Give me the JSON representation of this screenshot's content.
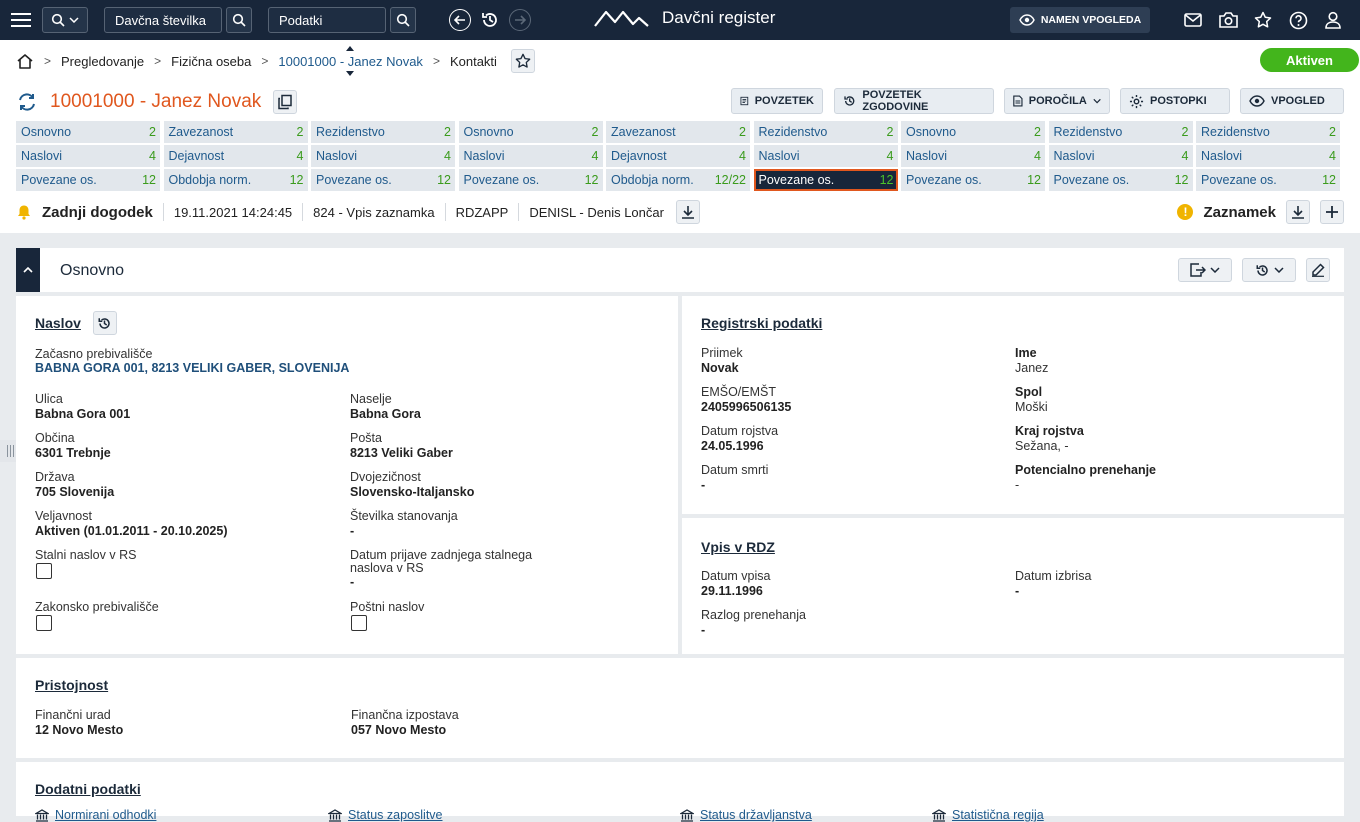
{
  "topbar": {
    "search_type": "Davčna številka",
    "search_field": "Podatki",
    "app_title": "Davčni register",
    "namen_button": "NAMEN VPOGLEDA"
  },
  "breadcrumb": {
    "items": [
      "Pregledovanje",
      "Fizična oseba",
      "10001000 - Janez Novak",
      "Kontakti"
    ]
  },
  "status_badge": "Aktiven",
  "page_title": "10001000 - Janez Novak",
  "actions": {
    "povzetek": "POVZETEK",
    "povzetek_zgodovine": "POVZETEK ZGODOVINE",
    "porocila": "POROČILA",
    "postopki": "POSTOPKI",
    "vpogled": "VPOGLED"
  },
  "tabs": [
    {
      "label": "Osnovno",
      "count": "2"
    },
    {
      "label": "Zavezanost",
      "count": "2"
    },
    {
      "label": "Rezidenstvo",
      "count": "2"
    },
    {
      "label": "Osnovno",
      "count": "2"
    },
    {
      "label": "Zavezanost",
      "count": "2"
    },
    {
      "label": "Rezidenstvo",
      "count": "2"
    },
    {
      "label": "Osnovno",
      "count": "2"
    },
    {
      "label": "Rezidenstvo",
      "count": "2"
    },
    {
      "label": "Rezidenstvo",
      "count": "2"
    },
    {
      "label": "Naslovi",
      "count": "4"
    },
    {
      "label": "Dejavnost",
      "count": "4"
    },
    {
      "label": "Naslovi",
      "count": "4"
    },
    {
      "label": "Naslovi",
      "count": "4"
    },
    {
      "label": "Dejavnost",
      "count": "4"
    },
    {
      "label": "Naslovi",
      "count": "4"
    },
    {
      "label": "Naslovi",
      "count": "4"
    },
    {
      "label": "Naslovi",
      "count": "4"
    },
    {
      "label": "Naslovi",
      "count": "4"
    },
    {
      "label": "Povezane os.",
      "count": "12"
    },
    {
      "label": "Obdobja norm.",
      "count": "12"
    },
    {
      "label": "Povezane os.",
      "count": "12"
    },
    {
      "label": "Povezane os.",
      "count": "12"
    },
    {
      "label": "Obdobja norm.",
      "count": "12/22"
    },
    {
      "label": "Povezane os.",
      "count": "12",
      "selected": true
    },
    {
      "label": "Povezane os.",
      "count": "12"
    },
    {
      "label": "Povezane os.",
      "count": "12"
    },
    {
      "label": "Povezane os.",
      "count": "12"
    }
  ],
  "event": {
    "label": "Zadnji dogodek",
    "datetime": "19.11.2021 14:24:45",
    "type": "824 - Vpis zaznamka",
    "app": "RDZAPP",
    "user": "DENISL - Denis Lončar",
    "note_label": "Zaznamek"
  },
  "section": {
    "title": "Osnovno"
  },
  "naslov": {
    "title": "Naslov",
    "temp_label": "Začasno prebivališče",
    "temp_value": "BABNA GORA 001, 8213 VELIKI GABER, SLOVENIJA",
    "ulica_l": "Ulica",
    "ulica_v": "Babna Gora 001",
    "naselje_l": "Naselje",
    "naselje_v": "Babna Gora",
    "obcina_l": "Občina",
    "obcina_v": "6301 Trebnje",
    "posta_l": "Pošta",
    "posta_v": "8213 Veliki Gaber",
    "drzava_l": "Država",
    "drzava_v": "705 Slovenija",
    "dvoj_l": "Dvojezičnost",
    "dvoj_v": "Slovensko-Italjansko",
    "velj_l": "Veljavnost",
    "velj_v": "Aktiven (01.01.2011 - 20.10.2025)",
    "stst_l": "Številka stanovanja",
    "stst_v": "-",
    "stalni_l": "Stalni naslov v RS",
    "datum_l1": "Datum prijave zadnjega stalnega",
    "datum_l2": "naslova v RS",
    "datum_v": "-",
    "zakon_l": "Zakonsko prebivališče",
    "postni_l": "Poštni naslov"
  },
  "registrski": {
    "title": "Registrski podatki",
    "priimek_l": "Priimek",
    "priimek_v": "Novak",
    "ime_l": "Ime",
    "ime_v": "Janez",
    "emso_l": "EMŠO/EMŠT",
    "emso_v": "2405996506135",
    "spol_l": "Spol",
    "spol_v": "Moški",
    "drojs_l": "Datum rojstva",
    "drojs_v": "24.05.1996",
    "krojs_l": "Kraj rojstva",
    "krojs_v": "Sežana, -",
    "dsmrti_l": "Datum smrti",
    "dsmrti_v": "-",
    "potenc_l": "Potencialno prenehanje",
    "potenc_v": "-"
  },
  "vpis": {
    "title": "Vpis v RDZ",
    "dvpisa_l": "Datum vpisa",
    "dvpisa_v": "29.11.1996",
    "dizbrisa_l": "Datum izbrisa",
    "dizbrisa_v": "-",
    "razlog_l": "Razlog prenehanja",
    "razlog_v": "-"
  },
  "pristojnost": {
    "title": "Pristojnost",
    "urad_l": "Finančni urad",
    "urad_v": "12 Novo Mesto",
    "izpostava_l": "Finančna izpostava",
    "izpostava_v": "057 Novo Mesto"
  },
  "dodatni": {
    "title": "Dodatni podatki",
    "links": [
      "Normirani odhodki",
      "Status zaposlitve",
      "Status državljanstva",
      "Statistična regija"
    ]
  }
}
